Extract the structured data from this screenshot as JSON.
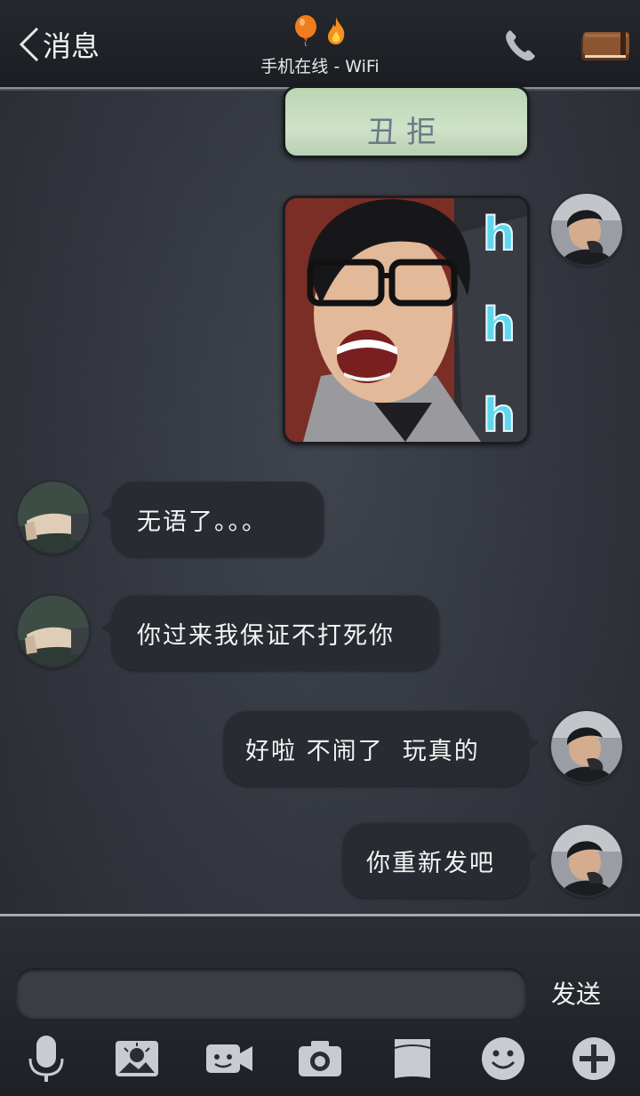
{
  "header": {
    "back_label": "消息",
    "status_text": "手机在线 - WiFi"
  },
  "messages": [
    {
      "type": "image",
      "side": "right",
      "caption": "丑拒"
    },
    {
      "type": "image",
      "side": "right",
      "overlay": "h h h"
    },
    {
      "type": "text",
      "side": "left",
      "text": "无语了。。。"
    },
    {
      "type": "text",
      "side": "left",
      "text": "你过来我保证不打死你"
    },
    {
      "type": "text",
      "side": "right",
      "text": "好啦 不闹了  玩真的"
    },
    {
      "type": "text",
      "side": "right",
      "text": "你重新发吧"
    }
  ],
  "composer": {
    "placeholder": "",
    "send_label": "发送"
  },
  "toolbar_icons": [
    "microphone-icon",
    "image-icon",
    "video-icon",
    "camera-icon",
    "folder-icon",
    "emoji-icon",
    "plus-icon"
  ],
  "colors": {
    "bubble": "#282b31",
    "topbar": "#1f2126",
    "text": "#f4f4f4"
  }
}
